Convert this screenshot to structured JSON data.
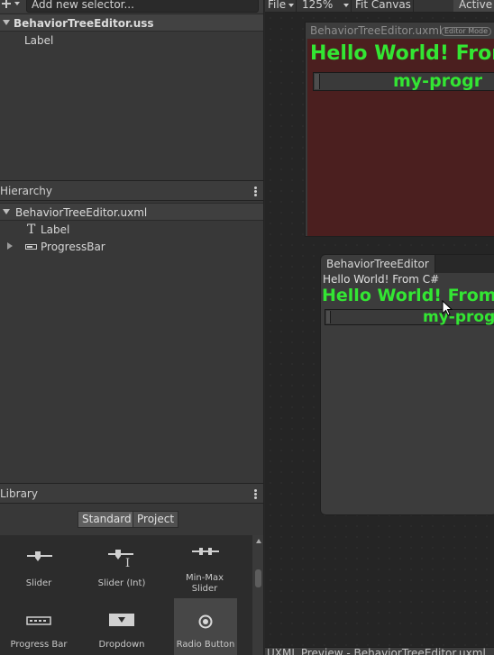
{
  "selectors_panel": {
    "add_icon": "plus-dropdown-icon",
    "input_value": "Add new selector...",
    "stylesheet_name": "BehaviorTreeEditor.uss",
    "selectors": [
      "Label"
    ]
  },
  "hierarchy_panel": {
    "title": "Hierarchy",
    "document_name": "BehaviorTreeEditor.uxml",
    "items": [
      {
        "icon": "text-label-icon",
        "label": "Label"
      },
      {
        "icon": "progress-bar-icon",
        "label": "ProgressBar"
      }
    ]
  },
  "library_panel": {
    "title": "Library",
    "tabs": [
      {
        "label": "Standard",
        "active": true
      },
      {
        "label": "Project",
        "active": false
      }
    ],
    "items": [
      {
        "icon": "slider-icon",
        "label": "Slider"
      },
      {
        "icon": "slider-int-icon",
        "label": "Slider (Int)"
      },
      {
        "icon": "min-max-slider-icon",
        "label": "Min-Max\nSlider"
      },
      {
        "icon": "progress-bar-icon",
        "label": "Progress Bar"
      },
      {
        "icon": "dropdown-icon",
        "label": "Dropdown"
      },
      {
        "icon": "radio-button-icon",
        "label": "Radio Button"
      }
    ]
  },
  "canvas_toolbar": {
    "file_label": "File",
    "zoom_label": "125%",
    "fit_canvas_label": "Fit Canvas",
    "active_label": "Active"
  },
  "uxml_canvas": {
    "header": "BehaviorTreeEditor.uxml",
    "mode_badge": "Editor Mode",
    "heading": "Hello World! From",
    "progress_title": "my-progr",
    "background_color": "#4b1f1f",
    "text_color": "#33e633"
  },
  "preview_window": {
    "tab": "BehaviorTreeEditor",
    "small_text": "Hello World! From C#",
    "heading": "Hello World! From U",
    "progress_title": "my-prog"
  },
  "bottom_bar": {
    "label": "UXML Preview - BehaviorTreeEditor.uxml"
  }
}
